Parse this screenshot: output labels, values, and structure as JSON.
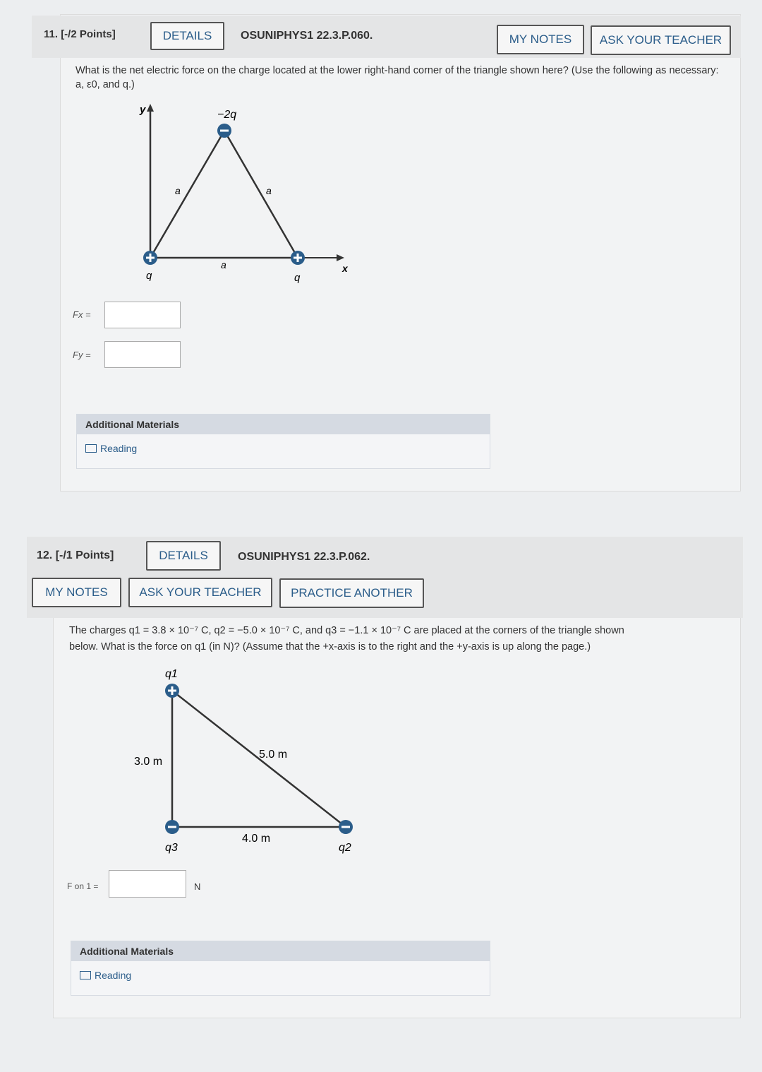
{
  "q11": {
    "number": "11. [-/2 Points]",
    "details": "DETAILS",
    "code": "OSUNIPHYS1 22.3.P.060.",
    "my_notes": "MY NOTES",
    "ask": "ASK YOUR TEACHER",
    "prompt": "What is the net electric force on the charge located at the lower right-hand corner of the triangle shown here? (Use the following as necessary: a, ε0, and q.)",
    "diagram": {
      "y": "y",
      "x": "x",
      "top": "−2q",
      "left_q": "q",
      "right_q": "q",
      "side_left": "a",
      "side_right": "a",
      "side_bottom": "a"
    },
    "fx_label": "Fx =",
    "fy_label": "Fy =",
    "fx_value": "",
    "fy_value": "",
    "additional": "Additional Materials",
    "reading": "Reading"
  },
  "q12": {
    "number": "12. [-/1 Points]",
    "details": "DETAILS",
    "code": "OSUNIPHYS1 22.3.P.062.",
    "my_notes": "MY NOTES",
    "ask": "ASK YOUR TEACHER",
    "practice": "PRACTICE ANOTHER",
    "prompt_line1": "The charges q1 = 3.8 × 10⁻⁷ C, q2 = −5.0 × 10⁻⁷ C, and q3 = −1.1 × 10⁻⁷ C are placed at the corners of the triangle shown",
    "prompt_line2": "below. What is the force on q1 (in N)? (Assume that the +x-axis is to the right and the +y-axis is up along the page.)",
    "diagram": {
      "q1": "q1",
      "q2": "q2",
      "q3": "q3",
      "vertical": "3.0 m",
      "hyp": "5.0 m",
      "horizontal": "4.0 m"
    },
    "f_label": "F on 1 =",
    "f_value": "",
    "unit": "N",
    "additional": "Additional Materials",
    "reading": "Reading"
  },
  "colors": {
    "positive": "#2b5d8a",
    "negative": "#2b5d8a",
    "link": "#2b5d8a"
  }
}
